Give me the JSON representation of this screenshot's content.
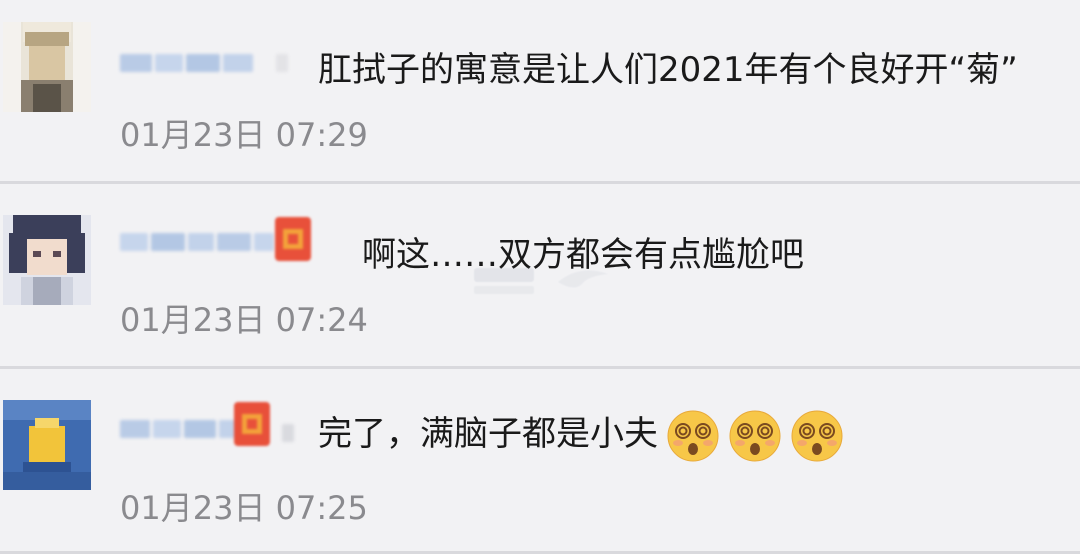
{
  "comments": [
    {
      "text": "肛拭子的寓意是让人们2021年有个良好开“菊”",
      "timestamp": "01月23日 07:29",
      "has_badge": false
    },
    {
      "text": "啊这……双方都会有点尴尬吧",
      "timestamp": "01月23日 07:24",
      "has_badge": true
    },
    {
      "text": "完了，满脑子都是小夫",
      "timestamp": "01月23日 07:25",
      "has_badge": true,
      "emojis": [
        "dizzy-face-emoji",
        "dizzy-face-emoji",
        "dizzy-face-emoji"
      ]
    }
  ],
  "colors": {
    "background": "#f2f2f4",
    "divider": "#d9d9dd",
    "text": "#1a1a1a",
    "timestamp": "#8a8a8e",
    "name_blur": "#b9cbe6",
    "badge_red": "#e8503a",
    "badge_orange": "#f3a23a"
  }
}
